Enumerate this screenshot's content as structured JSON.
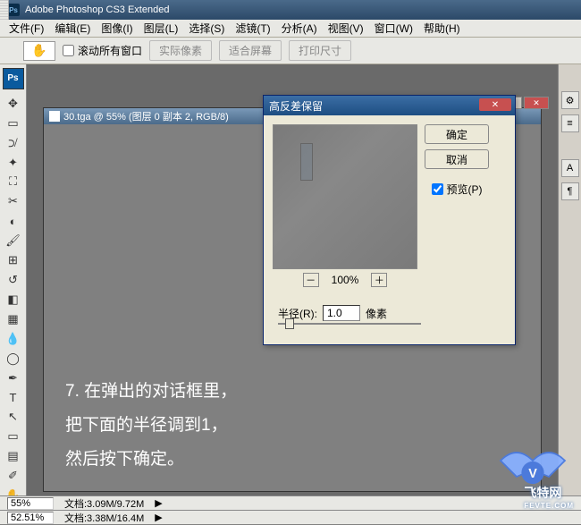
{
  "app": {
    "title": "Adobe Photoshop CS3 Extended"
  },
  "menu": {
    "file": "文件(F)",
    "edit": "编辑(E)",
    "image": "图像(I)",
    "layer": "图层(L)",
    "select": "选择(S)",
    "filter": "滤镜(T)",
    "analysis": "分析(A)",
    "view": "视图(V)",
    "window": "窗口(W)",
    "help": "帮助(H)"
  },
  "options": {
    "scroll_all": "滚动所有窗口",
    "actual_pixels": "实际像素",
    "fit_screen": "适合屏幕",
    "print_size": "打印尺寸"
  },
  "document": {
    "title": "30.tga @ 55% (图层 0 副本 2, RGB/8)"
  },
  "annotation": {
    "line1": "7. 在弹出的对话框里，",
    "line2": "把下面的半径调到1，",
    "line3": "然后按下确定。"
  },
  "dialog": {
    "title": "高反差保留",
    "ok": "确定",
    "cancel": "取消",
    "preview": "预览(P)",
    "zoom": "100%",
    "radius_label": "半径(R):",
    "radius_value": "1.0",
    "unit": "像素"
  },
  "status1": {
    "zoom": "55%",
    "doc": "文档:3.09M/9.72M"
  },
  "status2": {
    "zoom": "52.51%",
    "doc": "文档:3.38M/16.4M"
  },
  "watermark": {
    "text": "飞特网",
    "url": "FEVTE.COM"
  },
  "ps_badge": "Ps"
}
